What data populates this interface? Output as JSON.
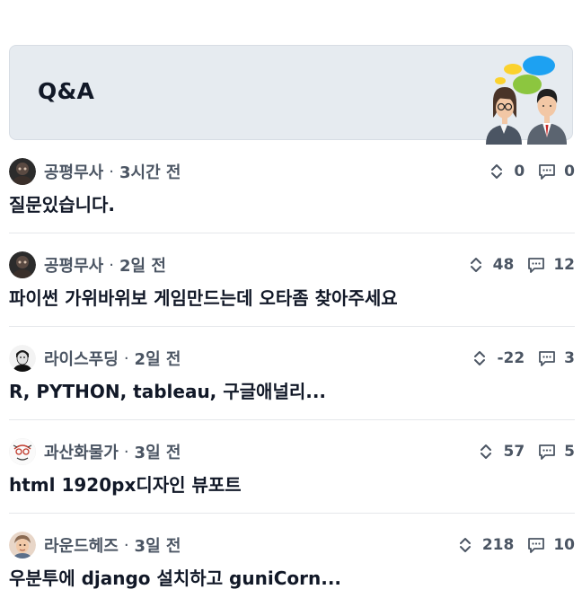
{
  "hero": {
    "title": "Q&A"
  },
  "posts": [
    {
      "author": "공평무사",
      "time": "3시간 전",
      "title": "질문있습니다.",
      "votes": "0",
      "comments": "0",
      "avatar": "dark-portrait"
    },
    {
      "author": "공평무사",
      "time": "2일 전",
      "title": "파이썬 가위바위보 게임만드는데 오타좀 찾아주세요",
      "votes": "48",
      "comments": "12",
      "avatar": "dark-portrait"
    },
    {
      "author": "라이스푸딩",
      "time": "2일 전",
      "title": "R, PYTHON, tableau, 구글애널리...",
      "votes": "-22",
      "comments": "3",
      "avatar": "bw-portrait"
    },
    {
      "author": "과산화물가",
      "time": "3일 전",
      "title": "html 1920px디자인 뷰포트",
      "votes": "57",
      "comments": "5",
      "avatar": "red-sketch"
    },
    {
      "author": "라운드헤즈",
      "time": "3일 전",
      "title": "우분투에 django 설치하고 guniCorn...",
      "votes": "218",
      "comments": "10",
      "avatar": "illustrated-face"
    }
  ],
  "icons": {
    "vote": "chevron-up-down-icon",
    "comment": "speech-bubble-icon"
  },
  "colors": {
    "hero_bg": "#e6ebf0",
    "text": "#111827",
    "muted": "#4b5563",
    "divider": "#e5e7eb"
  }
}
